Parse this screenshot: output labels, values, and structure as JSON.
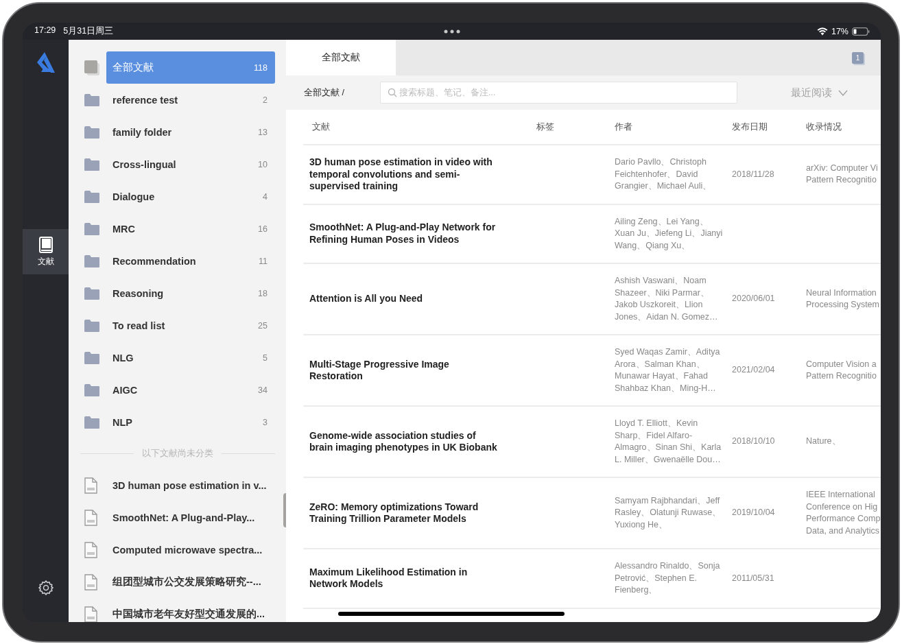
{
  "status_bar": {
    "time": "17:29",
    "date": "5月31日周三",
    "battery": "17%"
  },
  "rail": {
    "items": [
      {
        "label": "文献",
        "selected": true
      }
    ]
  },
  "sidebar": {
    "folders": [
      {
        "kind": "all",
        "name": "全部文献",
        "count": "118",
        "selected": true
      },
      {
        "kind": "folder",
        "name": "reference test",
        "count": "2",
        "selected": false
      },
      {
        "kind": "folder",
        "name": "family folder",
        "count": "13",
        "selected": false
      },
      {
        "kind": "folder",
        "name": "Cross-lingual",
        "count": "10",
        "selected": false
      },
      {
        "kind": "folder",
        "name": "Dialogue",
        "count": "4",
        "selected": false
      },
      {
        "kind": "folder",
        "name": "MRC",
        "count": "16",
        "selected": false
      },
      {
        "kind": "folder",
        "name": "Recommendation",
        "count": "11",
        "selected": false
      },
      {
        "kind": "folder",
        "name": "Reasoning",
        "count": "18",
        "selected": false
      },
      {
        "kind": "folder",
        "name": "To read list",
        "count": "25",
        "selected": false
      },
      {
        "kind": "folder",
        "name": "NLG",
        "count": "5",
        "selected": false
      },
      {
        "kind": "folder",
        "name": "AIGC",
        "count": "34",
        "selected": false
      },
      {
        "kind": "folder",
        "name": "NLP",
        "count": "3",
        "selected": false
      }
    ],
    "divider_label": "以下文献尚未分类",
    "documents": [
      "3D human pose estimation in v...",
      "SmoothNet: A Plug-and-Play...",
      "Computed microwave spectra...",
      "组团型城市公交发展策略研究--...",
      "中国城市老年友好型交通发展的..."
    ]
  },
  "main": {
    "tabs": [
      {
        "label": "全部文献",
        "selected": true
      }
    ],
    "badge": "1",
    "breadcrumb": "全部文献 /",
    "search": {
      "placeholder": "搜索标题、笔记、备注..."
    },
    "sort": "最近阅读",
    "table": {
      "columns": [
        "文献",
        "标签",
        "作者",
        "发布日期",
        "收录情况"
      ],
      "rows": [
        {
          "title": "3D human pose estimation in video with temporal convolutions and semi-supervised training",
          "authors": "Dario Pavllo、Christoph Feichtenhofer、David Grangier、Michael Auli、",
          "date": "2018/11/28",
          "venue": [
            "arXiv: Computer Vi",
            "Pattern Recognitio"
          ]
        },
        {
          "title": "SmoothNet: A Plug-and-Play Network for Refining Human Poses in Videos",
          "authors": "Ailing Zeng、Lei Yang、Xuan Ju、Jiefeng Li、Jianyi Wang、Qiang Xu、"
        },
        {
          "title": "Attention is All you Need",
          "authors": "Ashish Vaswani、Noam Shazeer、Niki Parmar、Jakob Uszkoreit、Llion Jones、Aidan N. Gomez…",
          "date": "2020/06/01",
          "venue": [
            "Neural Information",
            "Processing System"
          ]
        },
        {
          "title": "Multi-Stage Progressive Image Restoration",
          "authors": "Syed Waqas Zamir、Aditya Arora、Salman Khan、Munawar Hayat、Fahad Shahbaz Khan、Ming-H…",
          "date": "2021/02/04",
          "venue": [
            "Computer Vision a",
            "Pattern Recognitio"
          ]
        },
        {
          "title": "Genome-wide association studies of brain imaging phenotypes in UK Biobank",
          "authors": "Lloyd T. Elliott、Kevin Sharp、Fidel Alfaro-Almagro、Sinan Shi、Karla L. Miller、Gwenaëlle Dou…",
          "date": "2018/10/10",
          "venue": [
            "Nature、"
          ]
        },
        {
          "title": "ZeRO: Memory optimizations Toward Training Trillion Parameter Models",
          "authors": "Samyam Rajbhandari、Jeff Rasley、Olatunji Ruwase、Yuxiong He、",
          "date": "2019/10/04",
          "venue": [
            "IEEE International",
            "Conference on Hig",
            "Performance Comp",
            "Data, and Analytics"
          ]
        },
        {
          "title": "Maximum Likelihood Estimation in Network Models",
          "authors": "Alessandro Rinaldo、Sonja Petrović、Stephen E. Fienberg、",
          "date": "2011/05/31"
        }
      ]
    }
  }
}
